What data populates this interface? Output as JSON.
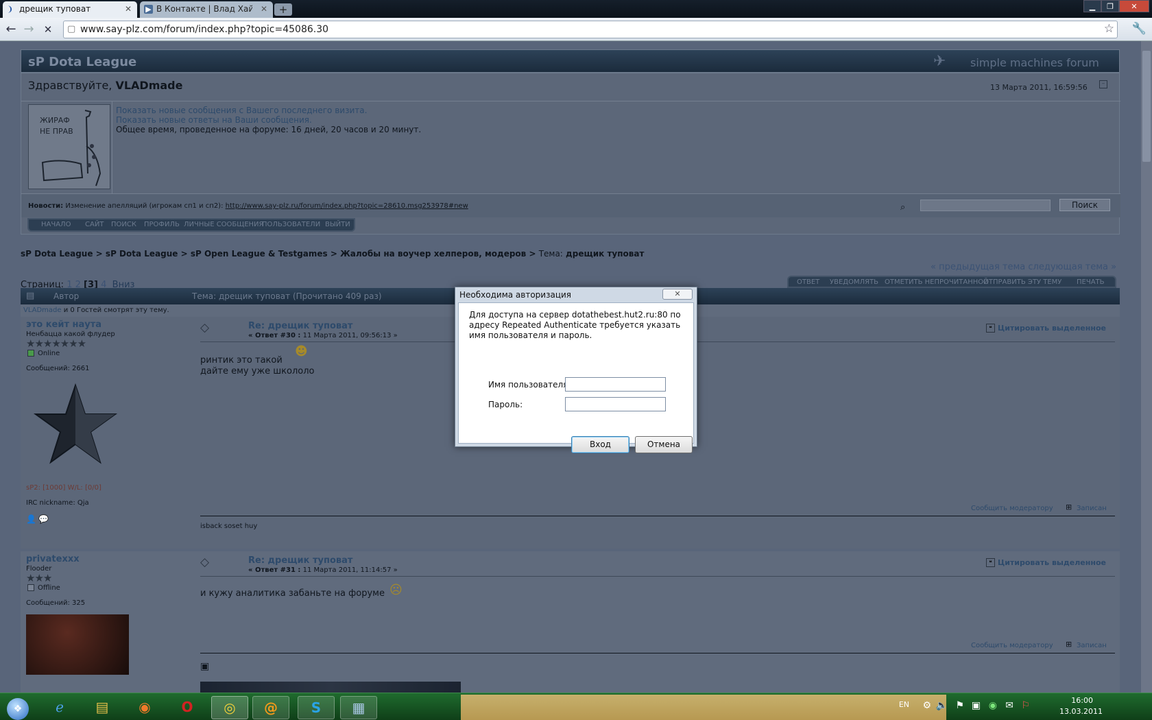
{
  "browser": {
    "tabs": [
      {
        "title": "дрещик туповат",
        "active": true
      },
      {
        "title": "В Контакте | Влад Хайду...",
        "active": false
      }
    ],
    "new_tab": "+",
    "address": "www.say-plz.com/forum/index.php?topic=45086.30"
  },
  "forum": {
    "site_title": "sP Dota League",
    "smf_brand": "simple machines forum",
    "greeting_prefix": "Здравствуйте, ",
    "username": "VLADmade",
    "datetime": "13 Марта 2011, 16:59:56",
    "avatar_text_1": "ЖИРАФ",
    "avatar_text_2": "НЕ ПРАВ",
    "link_new_posts": "Показать новые сообщения с Вашего последнего визита.",
    "link_new_replies": "Показать новые ответы на Ваши сообщения.",
    "total_time": "Общее время, проведенное на форуме: 16 дней, 20 часов и 20 минут.",
    "news_label": "Новости:",
    "news_text": "Изменение апелляций (игрокам сп1 и сп2):",
    "news_link": "http://www.say-plz.ru/forum/index.php?topic=28610.msg253978#new",
    "search_button": "Поиск",
    "menu": [
      "НАЧАЛО",
      "САЙТ",
      "ПОИСК",
      "ПРОФИЛЬ",
      "ЛИЧНЫЕ СООБЩЕНИЯ",
      "ПОЛЬЗОВАТЕЛИ",
      "ВЫЙТИ"
    ],
    "breadcrumb": [
      "sP Dota League",
      "sP Dota League",
      "sP Open League & Testgames",
      "Жалобы на воучер хелперов, модеров"
    ],
    "breadcrumb_topic_prefix": "Тема:",
    "breadcrumb_topic": "дрещик туповат",
    "prev_next": "« предыдущая тема следующая тема »",
    "pages_label": "Страниц:",
    "pages": [
      "1",
      "2",
      "[3]",
      "4"
    ],
    "down_link": "Вниз",
    "actions": [
      "ОТВЕТ",
      "УВЕДОМЛЯТЬ",
      "ОТМЕТИТЬ НЕПРОЧИТАННОЙ",
      "ОТПРАВИТЬ ЭТУ ТЕМУ",
      "ПЕЧАТЬ"
    ],
    "col_author": "Автор",
    "col_topic": "Тема: дрещик туповат  (Прочитано 409 раз)",
    "viewers_name": "VLADmade",
    "viewers_text": "и 0 Гостей смотрят эту тему.",
    "quote_selected": "Цитировать выделенное",
    "report_mod": "Сообщить модератору",
    "logged": "Записан",
    "posts": [
      {
        "author": "это кейт наута",
        "rank": "Ненбацца какой флудер",
        "status": "Online",
        "post_count": "Сообщений: 2661",
        "stats": "sP2: [1000] W/L: [0/0]",
        "irc": "IRC nickname: Qja",
        "subject": "Re: дрещик туповат",
        "meta_reply": "« Ответ #30 :",
        "meta_date": "11 Марта 2011, 09:56:13 »",
        "body_1": "ринтик это такой",
        "body_2": "дайте ему уже школоло",
        "signature": "isback soset huy",
        "stars": 7
      },
      {
        "author": "privatexxx",
        "rank": "Flooder",
        "status": "Offline",
        "post_count": "Сообщений: 325",
        "subject": "Re: дрещик туповат",
        "meta_reply": "« Ответ #31 :",
        "meta_date": "11 Марта 2011, 11:14:57 »",
        "body_1": "и кужу аналитика забаньте на форуме",
        "stars": 3
      }
    ]
  },
  "dialog": {
    "title": "Необходима авторизация",
    "message": "Для доступа на сервер dotathebest.hut2.ru:80 по адресу Repeated Authenticate требуется указать имя пользователя и пароль.",
    "username_label": "Имя пользователя:",
    "password_label": "Пароль:",
    "username_value": "",
    "password_value": "",
    "login_button": "Вход",
    "cancel_button": "Отмена"
  },
  "taskbar": {
    "language": "EN",
    "time": "16:00",
    "date": "13.03.2011"
  }
}
